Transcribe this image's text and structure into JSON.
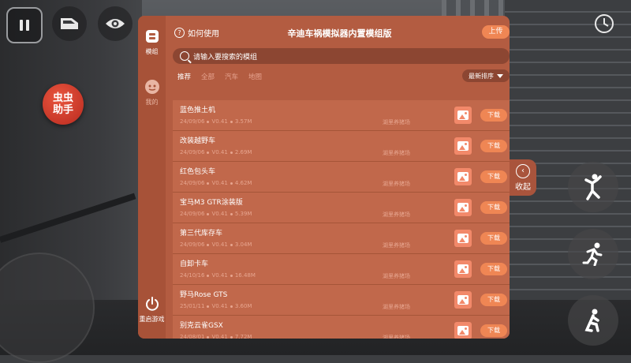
{
  "hud": {
    "fab_label": "虫虫\n助手"
  },
  "panel": {
    "help_label": "如何使用",
    "title": "辛迪车祸模拟器内置模组版",
    "upload_label": "上传",
    "search_placeholder": "请输入要搜索的模组",
    "tabs": [
      "推荐",
      "全部",
      "汽车",
      "地图"
    ],
    "sort_label": "最新排序",
    "sidebar": {
      "mod_label": "模组",
      "me_label": "我的",
      "restart_label": "重启游戏"
    },
    "collapse_label": "收起",
    "download_label": "下载",
    "items": [
      {
        "name": "蓝色推土机",
        "date": "24/09/06",
        "version": "V0.41",
        "size": "3.57M",
        "author": "湖里养猪场"
      },
      {
        "name": "改装越野车",
        "date": "24/09/06",
        "version": "V0.41",
        "size": "2.69M",
        "author": "湖里养猪场"
      },
      {
        "name": "红色包头车",
        "date": "24/09/06",
        "version": "V0.41",
        "size": "4.62M",
        "author": "湖里养猪场"
      },
      {
        "name": "宝马M3 GTR涂装版",
        "date": "24/09/06",
        "version": "V0.41",
        "size": "5.39M",
        "author": "湖里养猪场"
      },
      {
        "name": "第三代库存车",
        "date": "24/09/06",
        "version": "V0.41",
        "size": "3.04M",
        "author": "湖里养猪场"
      },
      {
        "name": "自卸卡车",
        "date": "24/10/16",
        "version": "V0.41",
        "size": "16.48M",
        "author": "湖里养猪场"
      },
      {
        "name": "野马Rose GTS",
        "date": "25/01/11",
        "version": "V0.41",
        "size": "3.60M",
        "author": "湖里养猪场"
      },
      {
        "name": "别克云雀GSX",
        "date": "24/08/01",
        "version": "V0.41",
        "size": "7.72M",
        "author": "湖里养猪场"
      }
    ]
  }
}
